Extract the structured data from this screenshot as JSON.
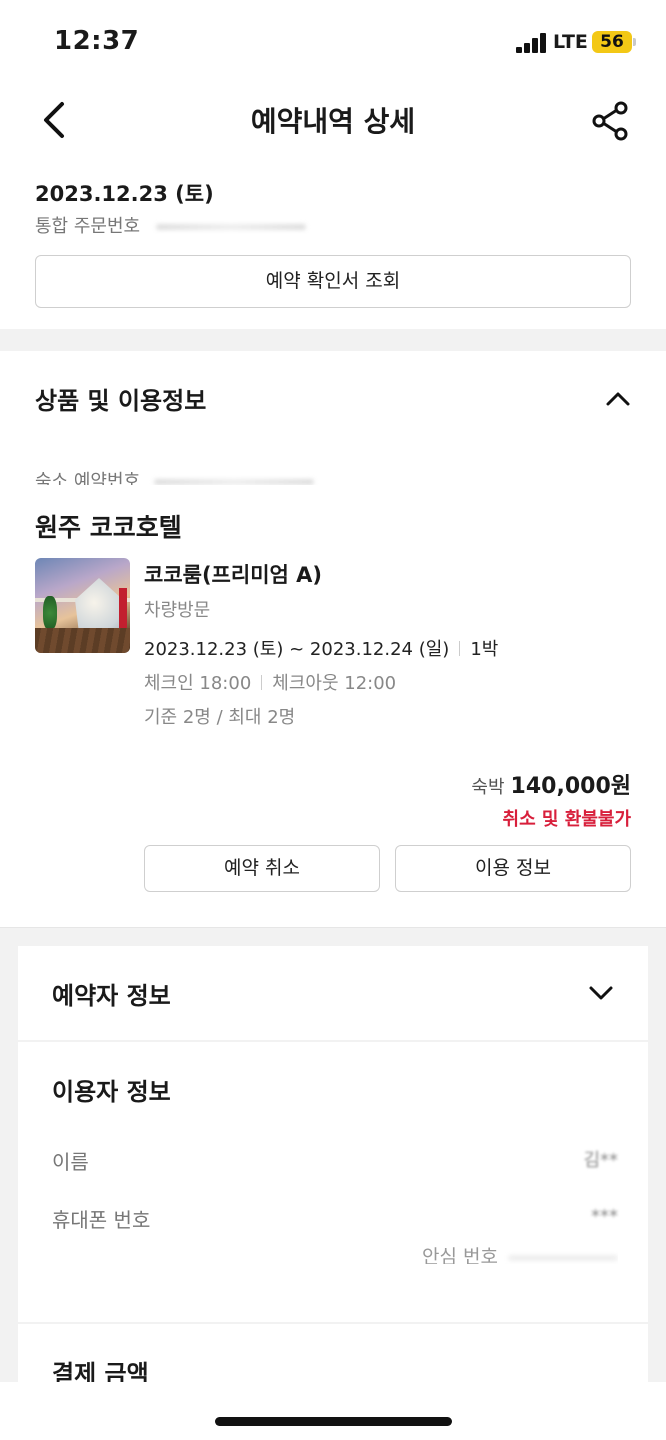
{
  "status_bar": {
    "time": "12:37",
    "network": "LTE",
    "battery": "56"
  },
  "header": {
    "title": "예약내역 상세"
  },
  "booking": {
    "date": "2023.12.23 (토)",
    "id_label": "통합 주문번호",
    "confirm_button": "예약 확인서 조회"
  },
  "product_section": {
    "title": "상품 및 이용정보",
    "accommodation_id_label": "숙소 예약번호",
    "hotel_name": "원주 코코호텔",
    "room_name": "코코룸(프리미엄 A)",
    "visit_type": "차량방문",
    "date_range": "2023.12.23 (토) ~ 2023.12.24 (일)",
    "nights": "1박",
    "check_in": "체크인 18:00",
    "check_out": "체크아웃 12:00",
    "guests": "기준 2명 / 최대 2명",
    "price_label": "숙박",
    "price": "140,000원",
    "refund_policy": "취소 및 환불불가",
    "cancel_button": "예약 취소",
    "info_button": "이용 정보"
  },
  "reserver_section": {
    "title": "예약자 정보"
  },
  "user_section": {
    "title": "이용자 정보",
    "name_label": "이름",
    "name_value": "김**",
    "phone_label": "휴대폰 번호",
    "phone_value": "***",
    "safe_number_label": "안심 번호"
  },
  "payment_section": {
    "title": "결제 금액"
  },
  "colors": {
    "accent_red": "#d81f3b",
    "battery": "#f3c816",
    "gap_gray": "#f2f2f2"
  },
  "icons": {
    "back": "chevron-left-icon",
    "share": "share-icon",
    "collapse": "chevron-up-icon",
    "expand": "chevron-down-icon"
  }
}
